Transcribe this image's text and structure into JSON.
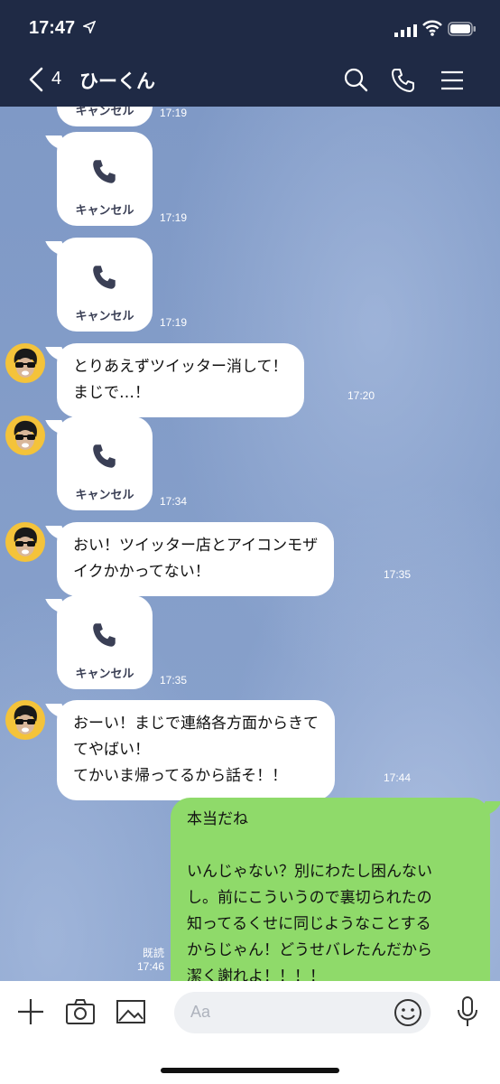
{
  "status_bar": {
    "time": "17:47"
  },
  "header": {
    "back_count": "4",
    "title": "ひーくん"
  },
  "messages": {
    "call_label": "キャンセル",
    "partial_call": {
      "time": "17:19"
    },
    "call1": {
      "time": "17:19"
    },
    "call2": {
      "time": "17:19"
    },
    "text1": {
      "text": "とりあえずツイッター消して！\nまじで…！",
      "time": "17:20"
    },
    "call3": {
      "time": "17:34"
    },
    "text2": {
      "text": "おい！ツイッター店とアイコンモザ\nイクかかってない！",
      "time": "17:35"
    },
    "call4": {
      "time": "17:35"
    },
    "text3": {
      "text": "おーい！まじで連絡各方面からきて\nてやばい！\nてかいま帰ってるから話そ！！",
      "time": "17:44"
    },
    "mine": {
      "text": "本当だね\n\nいんじゃない？別にわたし困んない\nし。前にこういうので裏切られたの\n知ってるくせに同じようなことする\nからじゃん！どうせバレたんだから\n潔く謝れよ！！！！",
      "read_label": "既読",
      "time": "17:46"
    }
  },
  "input": {
    "placeholder": "Aa"
  },
  "colors": {
    "header": "#1f2a45",
    "my_bubble": "#8fda6a",
    "chat_bg": "#8aa3cd"
  }
}
